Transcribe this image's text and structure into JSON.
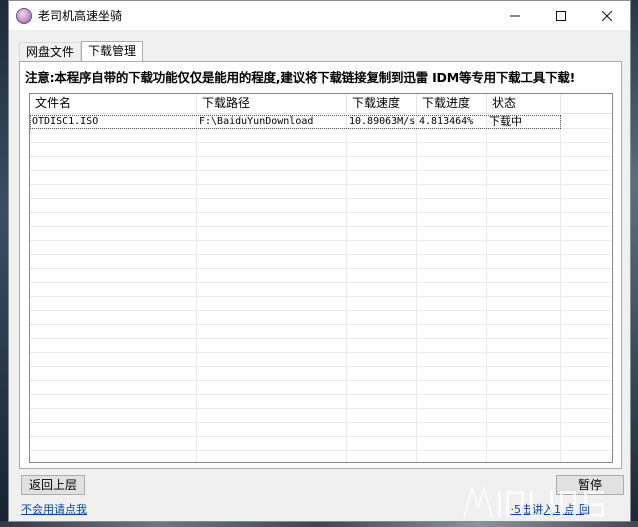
{
  "window": {
    "title": "老司机高速坐骑",
    "controls": {
      "minimize": "—",
      "maximize": "☐",
      "close": "✕"
    }
  },
  "tabs": [
    {
      "label": "网盘文件",
      "active": false
    },
    {
      "label": "下载管理",
      "active": true
    }
  ],
  "notice": "注意:本程序自带的下载功能仅仅是能用的程度,建议将下载链接复制到迅雷 IDM等专用下载工具下载!",
  "downloads": {
    "columns": [
      "文件名",
      "下载路径",
      "下载速度",
      "下载进度",
      "状态"
    ],
    "rows": [
      {
        "name": "OTDISC1.ISO",
        "path": "F:\\BaiduYunDownload",
        "speed": "10.89063M/s",
        "progress": "4.813464%",
        "status": "下载中"
      }
    ]
  },
  "buttons": {
    "back": "返回上层",
    "right": "暂停"
  },
  "links": {
    "help": "不会用请点我",
    "right": "·5击讲入1 点 回"
  },
  "colors": {
    "link": "#0645ad",
    "window_bg": "#f0f0f0",
    "title_bg": "#ffffff"
  }
}
